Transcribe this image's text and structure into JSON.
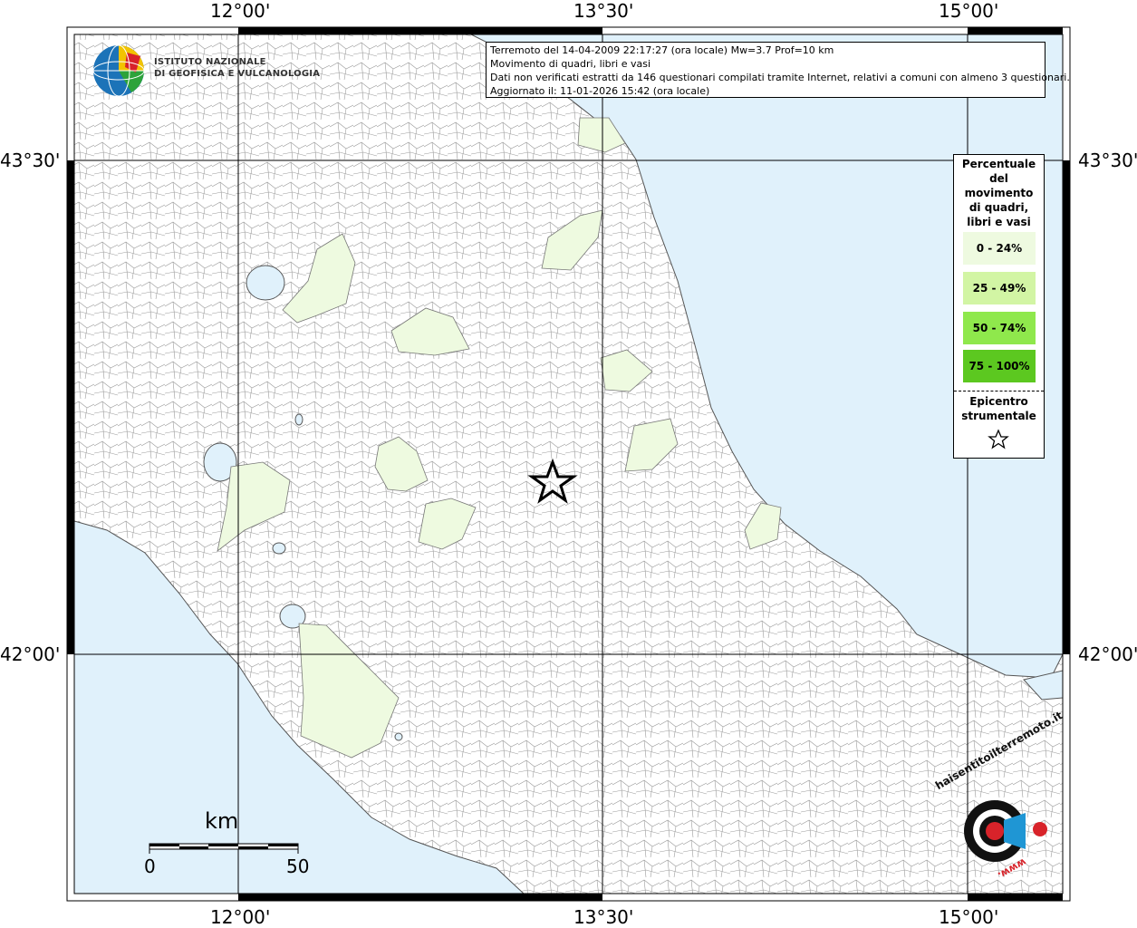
{
  "map": {
    "grid_labels": {
      "top": [
        "12°00'",
        "13°30'",
        "15°00'"
      ],
      "bottom": [
        "12°00'",
        "13°30'",
        "15°00'"
      ],
      "left": [
        "43°30'",
        "42°00'"
      ],
      "right": [
        "43°30'",
        "42°00'"
      ]
    },
    "colors": {
      "sea": "#e0f1fb",
      "land": "#ffffff",
      "class_0_24": "#eefae0",
      "class_25_49": "#d2f5a4",
      "class_50_74": "#8fe84c",
      "class_75_100": "#5cc820",
      "border": "#555555"
    }
  },
  "info": {
    "line1": "Terremoto del 14-04-2009 22:17:27 (ora locale) Mw=3.7 Prof=10 km",
    "line2": "Movimento di quadri, libri e vasi",
    "line3": "Dati non verificati estratti da 146 questionari compilati tramite Internet, relativi a comuni con almeno 3 questionari.",
    "line4": "Aggiornato il: 11-01-2026 15:42 (ora locale)"
  },
  "logo": {
    "line1": "ISTITUTO NAZIONALE",
    "line2": "DI GEOFISICA E VULCANOLOGIA"
  },
  "legend": {
    "title": [
      "Percentuale",
      "del",
      "movimento",
      "di quadri,",
      "libri e vasi"
    ],
    "classes": [
      "0 - 24%",
      "25 - 49%",
      "50 - 74%",
      "75 - 100%"
    ],
    "epicenter_title": [
      "Epicentro",
      "strumentale"
    ]
  },
  "scale": {
    "unit": "km",
    "start": "0",
    "end": "50"
  },
  "hst_logo": {
    "text": "haisentitoilterremoto.it",
    "url_text": "www."
  }
}
